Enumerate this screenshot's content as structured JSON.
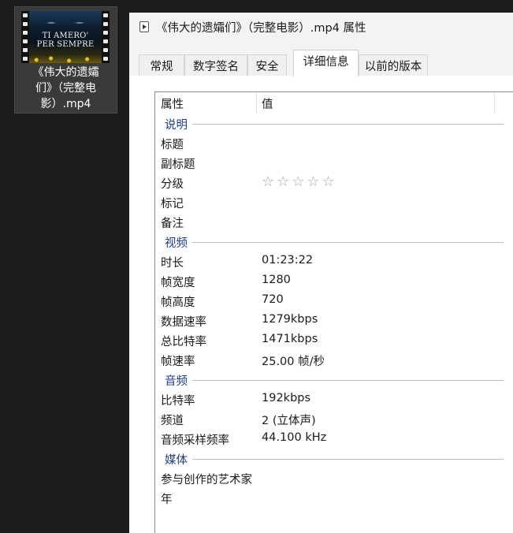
{
  "desktop": {
    "file_name": "《伟大的遗孀们》（完整电影）.mp4",
    "file_name_lines": [
      "《伟大的遗孀",
      "们》（完整电",
      "影）.mp4"
    ],
    "thumbnail_text_lines": [
      "TI AMERO'",
      "PER SEMPRE"
    ]
  },
  "window": {
    "title": "《伟大的遗孀们》（完整电影）.mp4 属性",
    "tabs": [
      {
        "label": "常规"
      },
      {
        "label": "数字签名"
      },
      {
        "label": "安全"
      },
      {
        "label": "详细信息"
      },
      {
        "label": "以前的版本"
      }
    ],
    "active_tab": "详细信息",
    "list": {
      "header": {
        "property": "属性",
        "value": "值"
      },
      "groups": [
        {
          "name": "说明",
          "rows": [
            {
              "name": "标题",
              "value": ""
            },
            {
              "name": "副标题",
              "value": ""
            },
            {
              "name": "分级",
              "value": "☆☆☆☆☆",
              "rating": 0
            },
            {
              "name": "标记",
              "value": ""
            },
            {
              "name": "备注",
              "value": ""
            }
          ]
        },
        {
          "name": "视频",
          "rows": [
            {
              "name": "时长",
              "value": "01:23:22"
            },
            {
              "name": "帧宽度",
              "value": "1280"
            },
            {
              "name": "帧高度",
              "value": "720"
            },
            {
              "name": "数据速率",
              "value": "1279kbps"
            },
            {
              "name": "总比特率",
              "value": "1471kbps"
            },
            {
              "name": "帧速率",
              "value": "25.00 帧/秒"
            }
          ]
        },
        {
          "name": "音频",
          "rows": [
            {
              "name": "比特率",
              "value": "192kbps"
            },
            {
              "name": "频道",
              "value": "2 (立体声)"
            },
            {
              "name": "音频采样频率",
              "value": "44.100 kHz"
            }
          ]
        },
        {
          "name": "媒体",
          "rows": [
            {
              "name": "参与创作的艺术家",
              "value": ""
            },
            {
              "name": "年",
              "value": ""
            }
          ]
        }
      ]
    }
  },
  "colors": {
    "desktop_bg": "#1c1c1c",
    "group_header": "#1e3c8c",
    "star_empty": "#a8a8a8"
  }
}
